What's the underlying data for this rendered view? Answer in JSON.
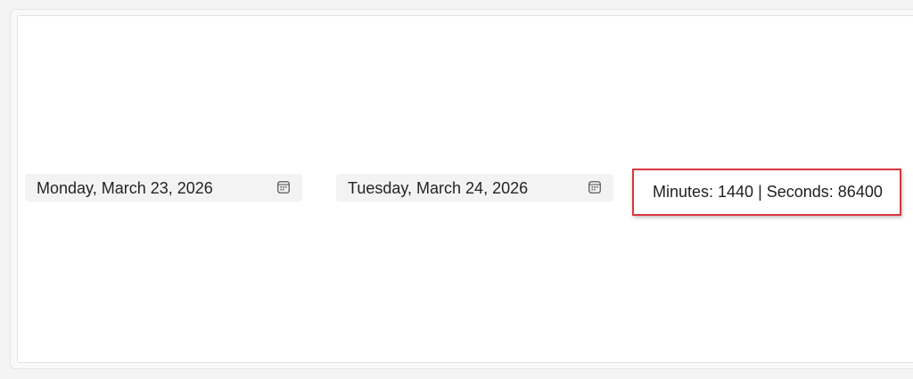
{
  "start_date": {
    "value": "Monday, March 23, 2026",
    "icon": "calendar-icon"
  },
  "end_date": {
    "value": "Tuesday, March 24, 2026",
    "icon": "calendar-icon"
  },
  "result": {
    "text": "Minutes: 1440 | Seconds: 86400",
    "highlight_color": "#d9363e"
  }
}
